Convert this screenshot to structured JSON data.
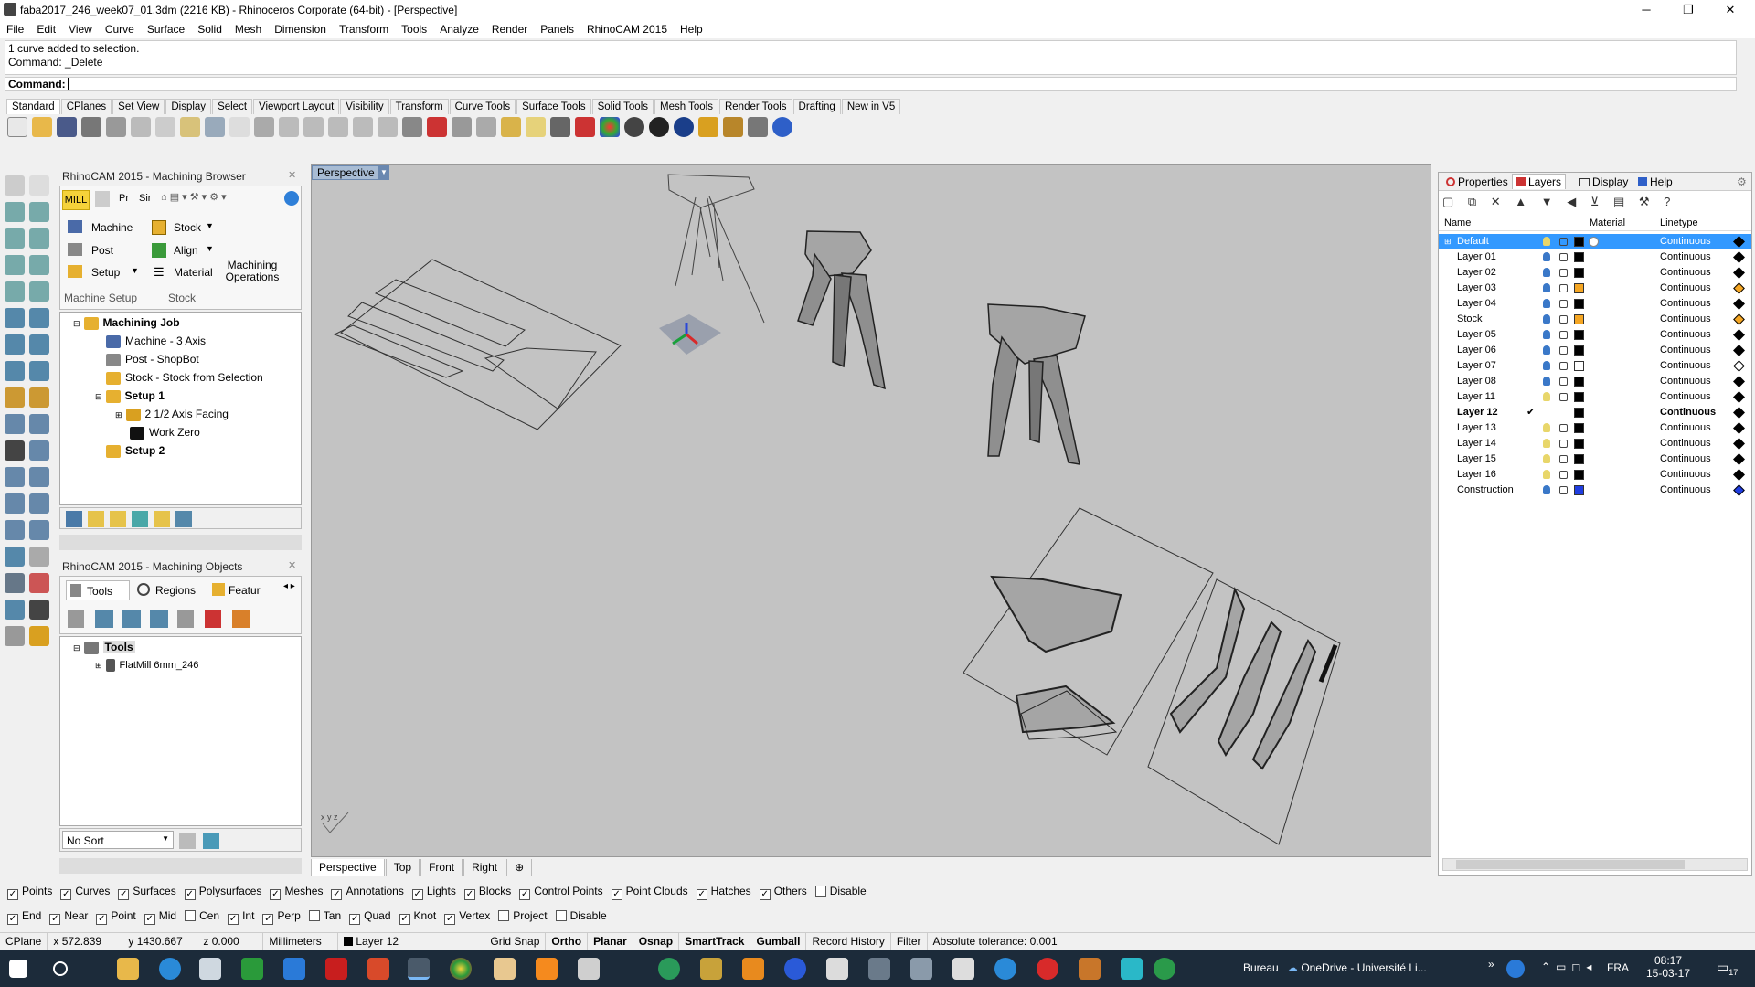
{
  "window": {
    "title": "faba2017_246_week07_01.3dm (2216 KB) - Rhinoceros Corporate (64-bit) - [Perspective]",
    "minimize": "─",
    "restore": "❐",
    "close": "✕"
  },
  "menu": [
    "File",
    "Edit",
    "View",
    "Curve",
    "Surface",
    "Solid",
    "Mesh",
    "Dimension",
    "Transform",
    "Tools",
    "Analyze",
    "Render",
    "Panels",
    "RhinoCAM 2015",
    "Help"
  ],
  "command": {
    "history1": "1 curve added to selection.",
    "history2": "Command: _Delete",
    "prompt": "Command:",
    "value": ""
  },
  "toolbar_tabs": [
    "Standard",
    "CPlanes",
    "Set View",
    "Display",
    "Select",
    "Viewport Layout",
    "Visibility",
    "Transform",
    "Curve Tools",
    "Surface Tools",
    "Solid Tools",
    "Mesh Tools",
    "Render Tools",
    "Drafting",
    "New in V5"
  ],
  "browser": {
    "title": "RhinoCAM 2015 - Machining Browser",
    "mode": "MILL",
    "tabs": [
      "Pr",
      "Sir"
    ],
    "machine": "Machine",
    "post": "Post",
    "setup": "Setup",
    "stock": "Stock",
    "align": "Align",
    "material": "Material",
    "machining_operations": "Machining Operations",
    "group_machine_setup": "Machine Setup",
    "group_stock": "Stock",
    "tree": [
      "Machining Job",
      "Machine - 3 Axis",
      "Post - ShopBot",
      "Stock - Stock from Selection",
      "Setup 1",
      "2 1/2 Axis Facing",
      "Work Zero",
      "Setup 2"
    ]
  },
  "objects": {
    "title": "RhinoCAM 2015 - Machining Objects",
    "tabs": [
      "Tools",
      "Regions",
      "Featur"
    ],
    "tree": [
      "Tools",
      "FlatMill 6mm_246"
    ],
    "sort": "No Sort"
  },
  "viewport": {
    "label": "Perspective",
    "tabs": [
      "Perspective",
      "Top",
      "Front",
      "Right"
    ],
    "axes": "x  y  z"
  },
  "panel_tabs": [
    "Properties",
    "Layers",
    "Display",
    "Help"
  ],
  "layers": {
    "columns": [
      "Name",
      "Material",
      "Linetype"
    ],
    "rows": [
      {
        "name": "Default",
        "line": "Continuous",
        "color": "#000000",
        "bulb": "#e8d66a",
        "dia": "#000000"
      },
      {
        "name": "Layer 01",
        "line": "Continuous",
        "color": "#000000",
        "bulb": "#3a78c8",
        "dia": "#000000"
      },
      {
        "name": "Layer 02",
        "line": "Continuous",
        "color": "#000000",
        "bulb": "#3a78c8",
        "dia": "#000000"
      },
      {
        "name": "Layer 03",
        "line": "Continuous",
        "color": "#f5a623",
        "bulb": "#3a78c8",
        "dia": "#f5a623"
      },
      {
        "name": "Layer 04",
        "line": "Continuous",
        "color": "#000000",
        "bulb": "#3a78c8",
        "dia": "#000000"
      },
      {
        "name": "Stock",
        "line": "Continuous",
        "color": "#f5a623",
        "bulb": "#3a78c8",
        "dia": "#f5a623"
      },
      {
        "name": "Layer 05",
        "line": "Continuous",
        "color": "#000000",
        "bulb": "#3a78c8",
        "dia": "#000000"
      },
      {
        "name": "Layer 06",
        "line": "Continuous",
        "color": "#000000",
        "bulb": "#3a78c8",
        "dia": "#000000"
      },
      {
        "name": "Layer 07",
        "line": "Continuous",
        "color": "#ffffff",
        "bulb": "#3a78c8",
        "dia": "#ffffff"
      },
      {
        "name": "Layer 08",
        "line": "Continuous",
        "color": "#000000",
        "bulb": "#3a78c8",
        "dia": "#000000"
      },
      {
        "name": "Layer 11",
        "line": "Continuous",
        "color": "#000000",
        "bulb": "#e8d66a",
        "dia": "#000000"
      },
      {
        "name": "Layer 12",
        "line": "Continuous",
        "color": "#000000",
        "bulb": "",
        "dia": "#000000",
        "current": true
      },
      {
        "name": "Layer 13",
        "line": "Continuous",
        "color": "#000000",
        "bulb": "#e8d66a",
        "dia": "#000000"
      },
      {
        "name": "Layer 14",
        "line": "Continuous",
        "color": "#000000",
        "bulb": "#e8d66a",
        "dia": "#000000"
      },
      {
        "name": "Layer 15",
        "line": "Continuous",
        "color": "#000000",
        "bulb": "#e8d66a",
        "dia": "#000000"
      },
      {
        "name": "Layer 16",
        "line": "Continuous",
        "color": "#000000",
        "bulb": "#e8d66a",
        "dia": "#000000"
      },
      {
        "name": "Construction",
        "line": "Continuous",
        "color": "#1f3de0",
        "bulb": "#3a78c8",
        "dia": "#1f3de0"
      }
    ]
  },
  "filters": [
    "Points",
    "Curves",
    "Surfaces",
    "Polysurfaces",
    "Meshes",
    "Annotations",
    "Lights",
    "Blocks",
    "Control Points",
    "Point Clouds",
    "Hatches",
    "Others",
    "Disable"
  ],
  "filters_checked": [
    true,
    true,
    true,
    true,
    true,
    true,
    true,
    true,
    true,
    true,
    true,
    true,
    false
  ],
  "osnaps": [
    "End",
    "Near",
    "Point",
    "Mid",
    "Cen",
    "Int",
    "Perp",
    "Tan",
    "Quad",
    "Knot",
    "Vertex",
    "Project",
    "Disable"
  ],
  "osnaps_checked": [
    true,
    true,
    true,
    true,
    false,
    true,
    true,
    false,
    true,
    true,
    true,
    false,
    false
  ],
  "status": {
    "cplane": "CPlane",
    "x": "x 572.839",
    "y": "y 1430.667",
    "z": "z 0.000",
    "units": "Millimeters",
    "layer": "Layer 12",
    "grid": "Grid Snap",
    "ortho": "Ortho",
    "planar": "Planar",
    "osnap": "Osnap",
    "smarttrack": "SmartTrack",
    "gumball": "Gumball",
    "history": "Record History",
    "filter": "Filter",
    "tolerance": "Absolute tolerance: 0.001"
  },
  "taskbar": {
    "bureau": "Bureau",
    "onedrive": "OneDrive - Université Li...",
    "lang": "FRA",
    "time": "08:17",
    "date": "15-03-17",
    "notif": "17"
  }
}
